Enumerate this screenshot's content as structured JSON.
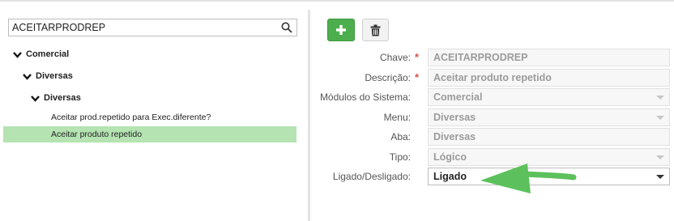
{
  "search": {
    "value": "ACEITARPRODREP"
  },
  "tree": {
    "nodes": [
      {
        "label": "Comercial"
      },
      {
        "label": "Diversas"
      },
      {
        "label": "Diversas"
      }
    ],
    "leaves": [
      {
        "label": "Aceitar prod.repetido para Exec.diferente?",
        "selected": false
      },
      {
        "label": "Aceitar produto repetido",
        "selected": true
      }
    ]
  },
  "toolbar": {
    "add_icon": "plus-icon",
    "delete_icon": "trash-icon"
  },
  "form": {
    "fields": [
      {
        "label": "Chave:",
        "value": "ACEITARPRODREP",
        "required": true,
        "type": "text"
      },
      {
        "label": "Descrição:",
        "value": "Aceitar produto repetido",
        "required": true,
        "type": "text"
      },
      {
        "label": "Módulos do Sistema:",
        "value": "Comercial",
        "required": false,
        "type": "select"
      },
      {
        "label": "Menu:",
        "value": "Diversas",
        "required": false,
        "type": "select"
      },
      {
        "label": "Aba:",
        "value": "Diversas",
        "required": false,
        "type": "text"
      },
      {
        "label": "Tipo:",
        "value": "Lógico",
        "required": false,
        "type": "select"
      },
      {
        "label": "Ligado/Desligado:",
        "value": "Ligado",
        "required": false,
        "type": "select"
      }
    ],
    "required_mark": "*"
  },
  "colors": {
    "accent_green": "#4cae4c",
    "selected_row": "#b5e3b2",
    "annotation_arrow": "#5cc15c",
    "required": "#d9534f"
  }
}
